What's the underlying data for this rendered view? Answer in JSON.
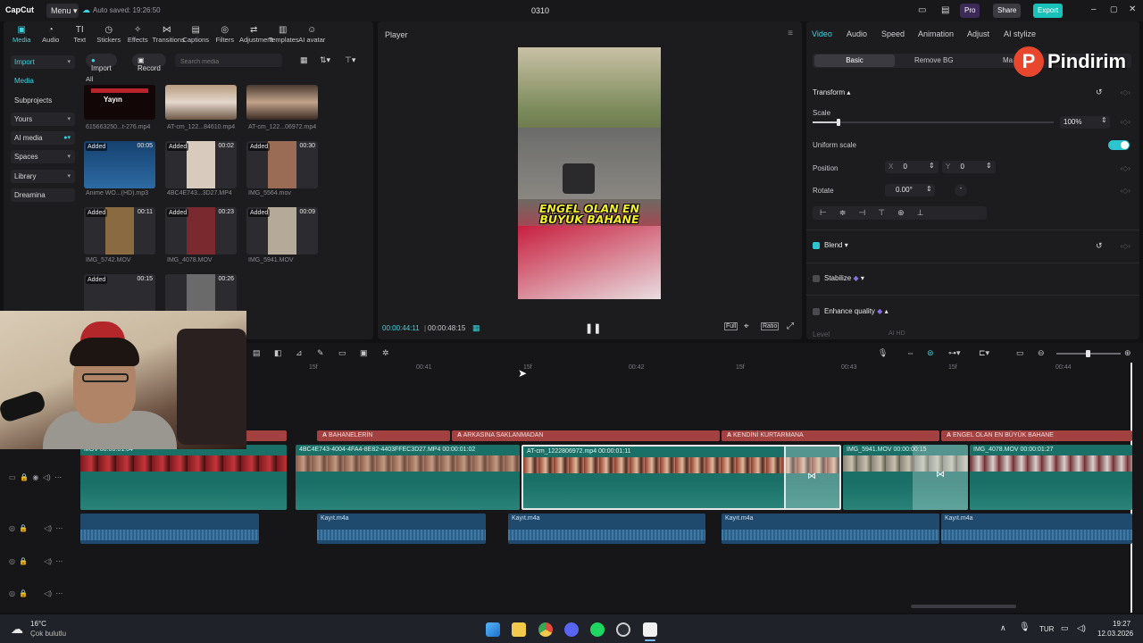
{
  "titlebar": {
    "app_name": "CapCut",
    "menu_label": "Menu",
    "autosave": "Auto saved: 19:26:50",
    "project_name": "0310",
    "pro_label": "Pro",
    "share_label": "Share",
    "export_label": "Export"
  },
  "tools": [
    {
      "label": "Media",
      "icon": "media-icon"
    },
    {
      "label": "Audio",
      "icon": "audio-icon"
    },
    {
      "label": "Text",
      "icon": "text-icon"
    },
    {
      "label": "Stickers",
      "icon": "stickers-icon"
    },
    {
      "label": "Effects",
      "icon": "effects-icon"
    },
    {
      "label": "Transitions",
      "icon": "transitions-icon"
    },
    {
      "label": "Captions",
      "icon": "captions-icon"
    },
    {
      "label": "Filters",
      "icon": "filters-icon"
    },
    {
      "label": "Adjustment",
      "icon": "adjustment-icon"
    },
    {
      "label": "Templates",
      "icon": "templates-icon"
    },
    {
      "label": "AI avatar",
      "icon": "ai-avatar-icon"
    }
  ],
  "sidenav": {
    "import": "Import",
    "media": "Media",
    "subprojects": "Subprojects",
    "yours": "Yours",
    "ai_media": "AI media",
    "spaces": "Spaces",
    "library": "Library",
    "dreamina": "Dreamina"
  },
  "media_toolbar": {
    "import": "Import",
    "record": "Record",
    "search_placeholder": "Search media",
    "filter_all": "All"
  },
  "media_items": [
    {
      "name": "615663250...t-276.mp4",
      "badge": "",
      "duration": ""
    },
    {
      "name": "AT-cm_122...84610.mp4",
      "badge": "",
      "duration": ""
    },
    {
      "name": "AT-cm_122...06972.mp4",
      "badge": "",
      "duration": ""
    },
    {
      "name": "Anime WO...(HD).mp3",
      "badge": "Added",
      "duration": "00:05"
    },
    {
      "name": "4BC4E743...3D27.MP4",
      "badge": "Added",
      "duration": "00:02"
    },
    {
      "name": "IMG_5564.mov",
      "badge": "Added",
      "duration": "00:30"
    },
    {
      "name": "IMG_5742.MOV",
      "badge": "Added",
      "duration": "00:11"
    },
    {
      "name": "IMG_4078.MOV",
      "badge": "Added",
      "duration": "00:23"
    },
    {
      "name": "IMG_5941.MOV",
      "badge": "Added",
      "duration": "00:09"
    },
    {
      "name": "",
      "badge": "Added",
      "duration": "00:15"
    },
    {
      "name": "",
      "badge": "",
      "duration": "00:26"
    }
  ],
  "thumb_overlay_text": "Yayın",
  "player": {
    "title": "Player",
    "caption": "ENGEL OLAN EN BÜYÜK BAHANE",
    "current_time": "00:00:44:11",
    "total_time": "00:00:48:15",
    "full_label": "Full",
    "ratio_label": "Ratio"
  },
  "inspector": {
    "tabs": [
      "Video",
      "Audio",
      "Speed",
      "Animation",
      "Adjust",
      "AI stylize"
    ],
    "subtabs": [
      "Basic",
      "Remove BG",
      "Ma"
    ],
    "transform": "Transform",
    "scale_label": "Scale",
    "scale_value": "100%",
    "scale_fraction": 0.1,
    "uniform_scale": "Uniform scale",
    "position_label": "Position",
    "pos_x_label": "X",
    "pos_x": "0",
    "pos_y_label": "Y",
    "pos_y": "0",
    "rotate_label": "Rotate",
    "rotate_value": "0.00°",
    "blend": "Blend",
    "stabilize": "Stabilize",
    "enhance_quality": "Enhance quality",
    "level_label": "Level",
    "level_value": "AI HD"
  },
  "watermark": {
    "letter": "P",
    "text": "Pindirim"
  },
  "timeline": {
    "ruler": [
      "15f",
      "00:41",
      "15f",
      "00:42",
      "15f",
      "00:43",
      "15f",
      "00:44"
    ],
    "text_clips": [
      "",
      "BAHANELERİN",
      "ARKASINA SAKLANMADAN",
      "KENDİNİ KURTARMANA",
      "ENGEL OLAN EN BÜYÜK BAHANE"
    ],
    "video_clips": [
      {
        "label": "MOV  00:00:01:04"
      },
      {
        "label": "4BC4E743-4004-4FA4-8E82-4403FFEC3D27.MP4  00:00:01:02"
      },
      {
        "label": "AT-cm_1222806972.mp4  00:00:01:11"
      },
      {
        "label": "IMG_5941.MOV  00:00:00:15"
      },
      {
        "label": "IMG_4078.MOV  00:00:01:27"
      }
    ],
    "audio_clips": [
      "",
      "Kayıt.m4a",
      "Kayıt.m4a",
      "Kayıt.m4a",
      "Kayıt.m4a"
    ]
  },
  "taskbar": {
    "temperature": "16°C",
    "weather": "Çok bulutlu",
    "language": "TUR",
    "time": "19:27",
    "date": "12.03.2026"
  },
  "colors": {
    "accent": "#3ad5e0",
    "export": "#18c2b8",
    "text_clip": "#a34141",
    "video_clip": "#1a6f66",
    "audio_clip": "#1f4a6e"
  }
}
